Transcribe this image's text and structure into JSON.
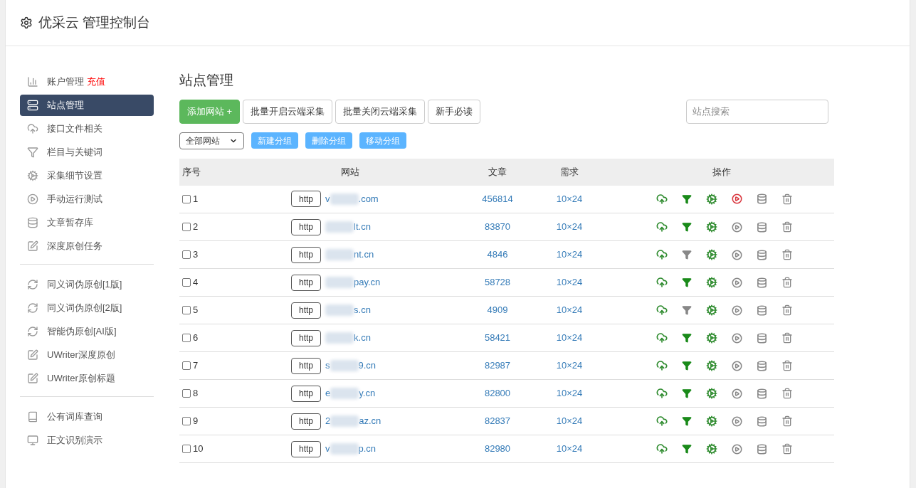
{
  "header": {
    "title": "优采云 管理控制台"
  },
  "sidebar": {
    "groups": [
      {
        "items": [
          {
            "label": "账户管理",
            "badge": "充值",
            "selected": false
          },
          {
            "label": "站点管理",
            "selected": true
          },
          {
            "label": "接口文件相关",
            "selected": false
          },
          {
            "label": "栏目与关键词",
            "selected": false
          },
          {
            "label": "采集细节设置",
            "selected": false
          },
          {
            "label": "手动运行测试",
            "selected": false
          },
          {
            "label": "文章暂存库",
            "selected": false
          },
          {
            "label": "深度原创任务",
            "selected": false
          }
        ]
      },
      {
        "items": [
          {
            "label": "同义词伪原创[1版]",
            "selected": false
          },
          {
            "label": "同义词伪原创[2版]",
            "selected": false
          },
          {
            "label": "智能伪原创[AI版]",
            "selected": false
          },
          {
            "label": "UWriter深度原创",
            "selected": false
          },
          {
            "label": "UWriter原创标题",
            "selected": false
          }
        ]
      },
      {
        "items": [
          {
            "label": "公有词库查询",
            "selected": false
          },
          {
            "label": "正文识别演示",
            "selected": false
          }
        ]
      }
    ]
  },
  "main": {
    "title": "站点管理",
    "toolbar": [
      {
        "label": "添加网站 +",
        "kind": "primary"
      },
      {
        "label": "批量开启云端采集",
        "kind": "default"
      },
      {
        "label": "批量关闭云端采集",
        "kind": "default"
      },
      {
        "label": "新手必读",
        "kind": "default"
      }
    ],
    "search": {
      "placeholder": "站点搜索"
    },
    "group_select": {
      "value": "全部网站"
    },
    "group_buttons": [
      "新建分组",
      "删除分组",
      "移动分组"
    ],
    "table": {
      "columns": [
        "序号",
        "网站",
        "文章",
        "需求",
        "操作"
      ],
      "rows": [
        {
          "index": "1",
          "checked": false,
          "protocol": "http",
          "domain_start": "v",
          "domain_end": ".com",
          "articles": "456814",
          "demand": "10×24",
          "filter_on": true,
          "running": true
        },
        {
          "index": "2",
          "checked": false,
          "protocol": "http",
          "domain_start": "",
          "domain_end": "lt.cn",
          "articles": "83870",
          "demand": "10×24",
          "filter_on": true,
          "running": false
        },
        {
          "index": "3",
          "checked": false,
          "protocol": "http",
          "domain_start": "",
          "domain_end": "nt.cn",
          "articles": "4846",
          "demand": "10×24",
          "filter_on": false,
          "running": false
        },
        {
          "index": "4",
          "checked": false,
          "protocol": "http",
          "domain_start": "",
          "domain_end": "pay.cn",
          "articles": "58728",
          "demand": "10×24",
          "filter_on": true,
          "running": false
        },
        {
          "index": "5",
          "checked": false,
          "protocol": "http",
          "domain_start": "",
          "domain_end": "s.cn",
          "articles": "4909",
          "demand": "10×24",
          "filter_on": false,
          "running": false
        },
        {
          "index": "6",
          "checked": false,
          "protocol": "http",
          "domain_start": "",
          "domain_end": "k.cn",
          "articles": "58421",
          "demand": "10×24",
          "filter_on": true,
          "running": false
        },
        {
          "index": "7",
          "checked": false,
          "protocol": "http",
          "domain_start": "s",
          "domain_end": "9.cn",
          "articles": "82987",
          "demand": "10×24",
          "filter_on": true,
          "running": false
        },
        {
          "index": "8",
          "checked": false,
          "protocol": "http",
          "domain_start": "e",
          "domain_end": "y.cn",
          "articles": "82800",
          "demand": "10×24",
          "filter_on": true,
          "running": false
        },
        {
          "index": "9",
          "checked": false,
          "protocol": "http",
          "domain_start": "2",
          "domain_end": "az.cn",
          "articles": "82837",
          "demand": "10×24",
          "filter_on": true,
          "running": false
        },
        {
          "index": "10",
          "checked": false,
          "protocol": "http",
          "domain_start": "v",
          "domain_end": "p.cn",
          "articles": "82980",
          "demand": "10×24",
          "filter_on": true,
          "running": false
        }
      ]
    }
  }
}
